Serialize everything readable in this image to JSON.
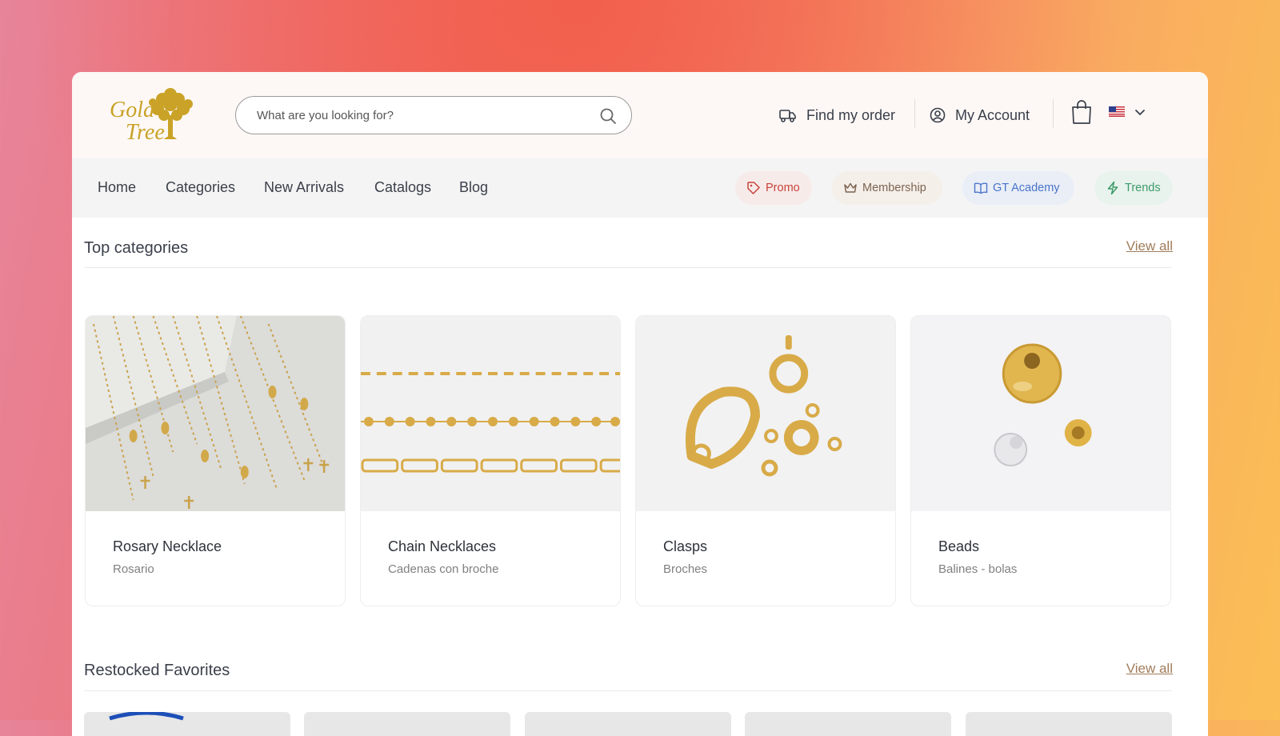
{
  "header": {
    "logo_text_line1": "Gold",
    "logo_text_line2": "Tree",
    "search_placeholder": "What are you looking for?",
    "find_order_label": "Find my order",
    "account_label": "My Account",
    "language_flag": "us-flag-icon"
  },
  "nav": {
    "items": [
      {
        "label": "Home"
      },
      {
        "label": "Categories"
      },
      {
        "label": "New Arrivals"
      },
      {
        "label": "Catalogs"
      },
      {
        "label": "Blog"
      }
    ],
    "pills": [
      {
        "label": "Promo",
        "icon": "tag-icon",
        "color": "#c9433c",
        "bg": "#f7ebe9"
      },
      {
        "label": "Membership",
        "icon": "crown-icon",
        "color": "#7d6450",
        "bg": "#f5efea"
      },
      {
        "label": "GT Academy",
        "icon": "book-icon",
        "color": "#4a74c9",
        "bg": "#e9eef7"
      },
      {
        "label": "Trends",
        "icon": "bolt-icon",
        "color": "#3d9a6a",
        "bg": "#e7f3ec"
      }
    ]
  },
  "top_categories": {
    "title": "Top categories",
    "view_all": "View all",
    "cards": [
      {
        "title": "Rosary Necklace",
        "subtitle": "Rosario"
      },
      {
        "title": "Chain Necklaces",
        "subtitle": "Cadenas con broche"
      },
      {
        "title": "Clasps",
        "subtitle": "Broches"
      },
      {
        "title": "Beads",
        "subtitle": "Balines - bolas"
      }
    ]
  },
  "restocked": {
    "title": "Restocked Favorites",
    "view_all": "View all"
  },
  "colors": {
    "accent_brown": "#a07c5a",
    "logo_gold": "#c9a227"
  }
}
